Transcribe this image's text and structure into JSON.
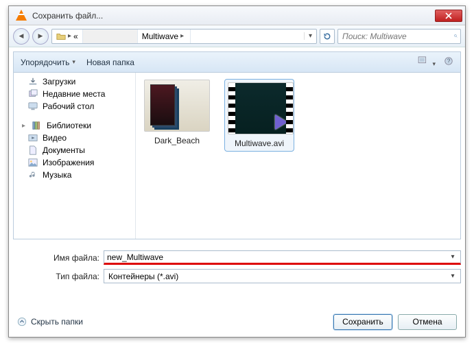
{
  "window": {
    "title": "Сохранить файл..."
  },
  "nav": {
    "segments": [
      "«",
      "Multiwave"
    ],
    "search_placeholder": "Поиск: Multiwave"
  },
  "toolbar": {
    "organize": "Упорядочить",
    "new_folder": "Новая папка"
  },
  "tree": {
    "items": [
      {
        "label": "Загрузки"
      },
      {
        "label": "Недавние места"
      },
      {
        "label": "Рабочий стол"
      }
    ],
    "library_label": "Библиотеки",
    "library_items": [
      {
        "label": "Видео"
      },
      {
        "label": "Документы"
      },
      {
        "label": "Изображения"
      },
      {
        "label": "Музыка"
      }
    ]
  },
  "files": [
    {
      "name": "Dark_Beach",
      "kind": "folder"
    },
    {
      "name": "Multiwave.avi",
      "kind": "video",
      "selected": true
    }
  ],
  "form": {
    "filename_label": "Имя файла:",
    "filename_value": "new_Multiwave",
    "filetype_label": "Тип файла:",
    "filetype_value": "Контейнеры (*.avi)"
  },
  "footer": {
    "hide_folders": "Скрыть папки",
    "save": "Сохранить",
    "cancel": "Отмена"
  }
}
